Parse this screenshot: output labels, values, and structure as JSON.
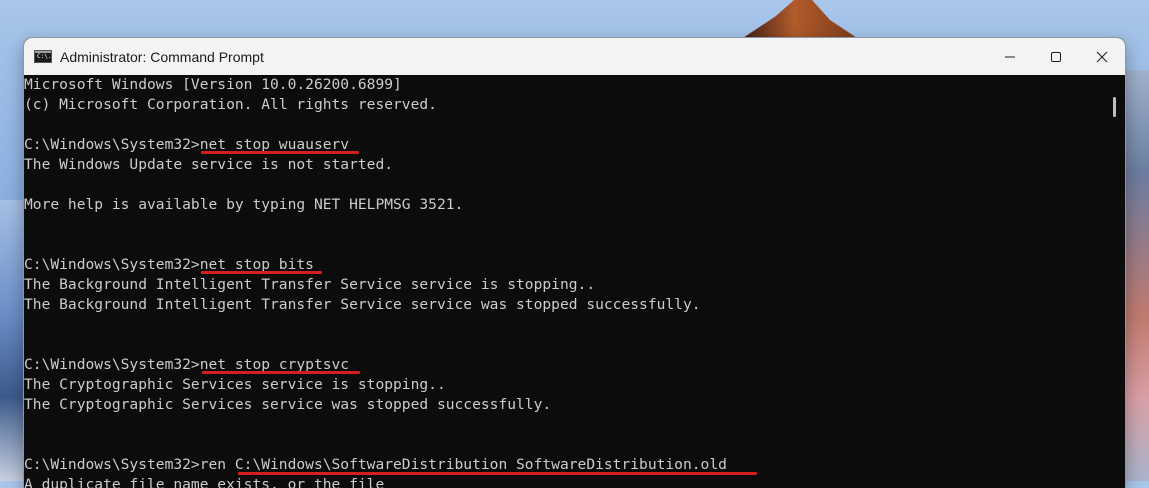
{
  "window": {
    "title": "Administrator: Command Prompt",
    "icon": "cmd-icon",
    "icon_text": "C:\\.",
    "controls": [
      "minimize-icon",
      "maximize-icon",
      "close-icon"
    ]
  },
  "console": {
    "lines": [
      "Microsoft Windows [Version 10.0.26200.6899]",
      "(c) Microsoft Corporation. All rights reserved.",
      "",
      "C:\\Windows\\System32>net stop wuauserv",
      "The Windows Update service is not started.",
      "",
      "More help is available by typing NET HELPMSG 3521.",
      "",
      "",
      "C:\\Windows\\System32>net stop bits",
      "The Background Intelligent Transfer Service service is stopping..",
      "The Background Intelligent Transfer Service service was stopped successfully.",
      "",
      "",
      "C:\\Windows\\System32>net stop cryptsvc",
      "The Cryptographic Services service is stopping..",
      "The Cryptographic Services service was stopped successfully.",
      "",
      "",
      "C:\\Windows\\System32>ren C:\\Windows\\SoftwareDistribution SoftwareDistribution.old",
      "A duplicate file name exists, or the file"
    ]
  },
  "colors": {
    "console_bg": "#0c0c0c",
    "console_text": "#cccccc",
    "highlight_underline": "#d41f1f",
    "titlebar_bg": "#f3f3f3"
  }
}
